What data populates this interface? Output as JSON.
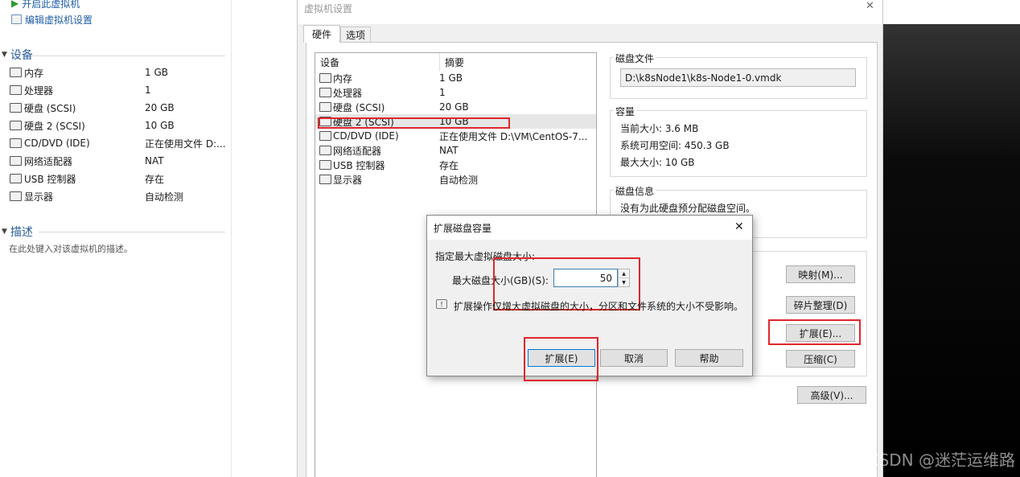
{
  "left": {
    "actions": [
      {
        "label": "开启此虚拟机"
      },
      {
        "label": "编辑虚拟机设置"
      }
    ],
    "devices_title": "设备",
    "devices": [
      {
        "name": "内存",
        "value": "1 GB"
      },
      {
        "name": "处理器",
        "value": "1"
      },
      {
        "name": "硬盘 (SCSI)",
        "value": "20 GB"
      },
      {
        "name": "硬盘 2 (SCSI)",
        "value": "10 GB"
      },
      {
        "name": "CD/DVD (IDE)",
        "value": "正在使用文件 D:..."
      },
      {
        "name": "网络适配器",
        "value": "NAT"
      },
      {
        "name": "USB 控制器",
        "value": "存在"
      },
      {
        "name": "显示器",
        "value": "自动检测"
      }
    ],
    "desc_title": "描述",
    "desc_text": "在此处键入对该虚拟机的描述。"
  },
  "window": {
    "title": "虚拟机设置",
    "close": "✕",
    "tabs": [
      {
        "label": "硬件"
      },
      {
        "label": "选项"
      }
    ],
    "list_headers": {
      "device": "设备",
      "summary": "摘要"
    },
    "devices": [
      {
        "name": "内存",
        "value": "1 GB"
      },
      {
        "name": "处理器",
        "value": "1"
      },
      {
        "name": "硬盘 (SCSI)",
        "value": "20 GB"
      },
      {
        "name": "硬盘 2 (SCSI)",
        "value": "10 GB"
      },
      {
        "name": "CD/DVD (IDE)",
        "value": "正在使用文件 D:\\VM\\CentOS-7..."
      },
      {
        "name": "网络适配器",
        "value": "NAT"
      },
      {
        "name": "USB 控制器",
        "value": "存在"
      },
      {
        "name": "显示器",
        "value": "自动检测"
      }
    ],
    "selected_index": 3,
    "disk_file": {
      "label": "磁盘文件",
      "value": "D:\\k8sNode1\\k8s-Node1-0.vmdk"
    },
    "capacity": {
      "label": "容量",
      "current": "当前大小: 3.6 MB",
      "available": "系统可用空间: 450.3 GB",
      "max": "最大大小: 10 GB"
    },
    "disk_info": {
      "label": "磁盘信息",
      "text": "没有为此硬盘预分配磁盘空间。"
    },
    "buttons": {
      "map": "映射(M)...",
      "defrag": "碎片整理(D)",
      "expand": "扩展(E)...",
      "compact": "压缩(C)",
      "advanced": "高级(V)..."
    }
  },
  "dialog": {
    "title": "扩展磁盘容量",
    "close": "✕",
    "prompt": "指定最大虚拟磁盘大小:",
    "field_label": "最大磁盘大小(GB)(S):",
    "field_value": "50",
    "info": "扩展操作仅增大虚拟磁盘的大小，分区和文件系统的大小不受影响。",
    "buttons": {
      "expand": "扩展(E)",
      "cancel": "取消",
      "help": "帮助"
    }
  },
  "watermark": "CSDN @迷茫运维路",
  "colors": {
    "highlight_red": "#e0262b",
    "link_blue": "#1f5ea8"
  }
}
